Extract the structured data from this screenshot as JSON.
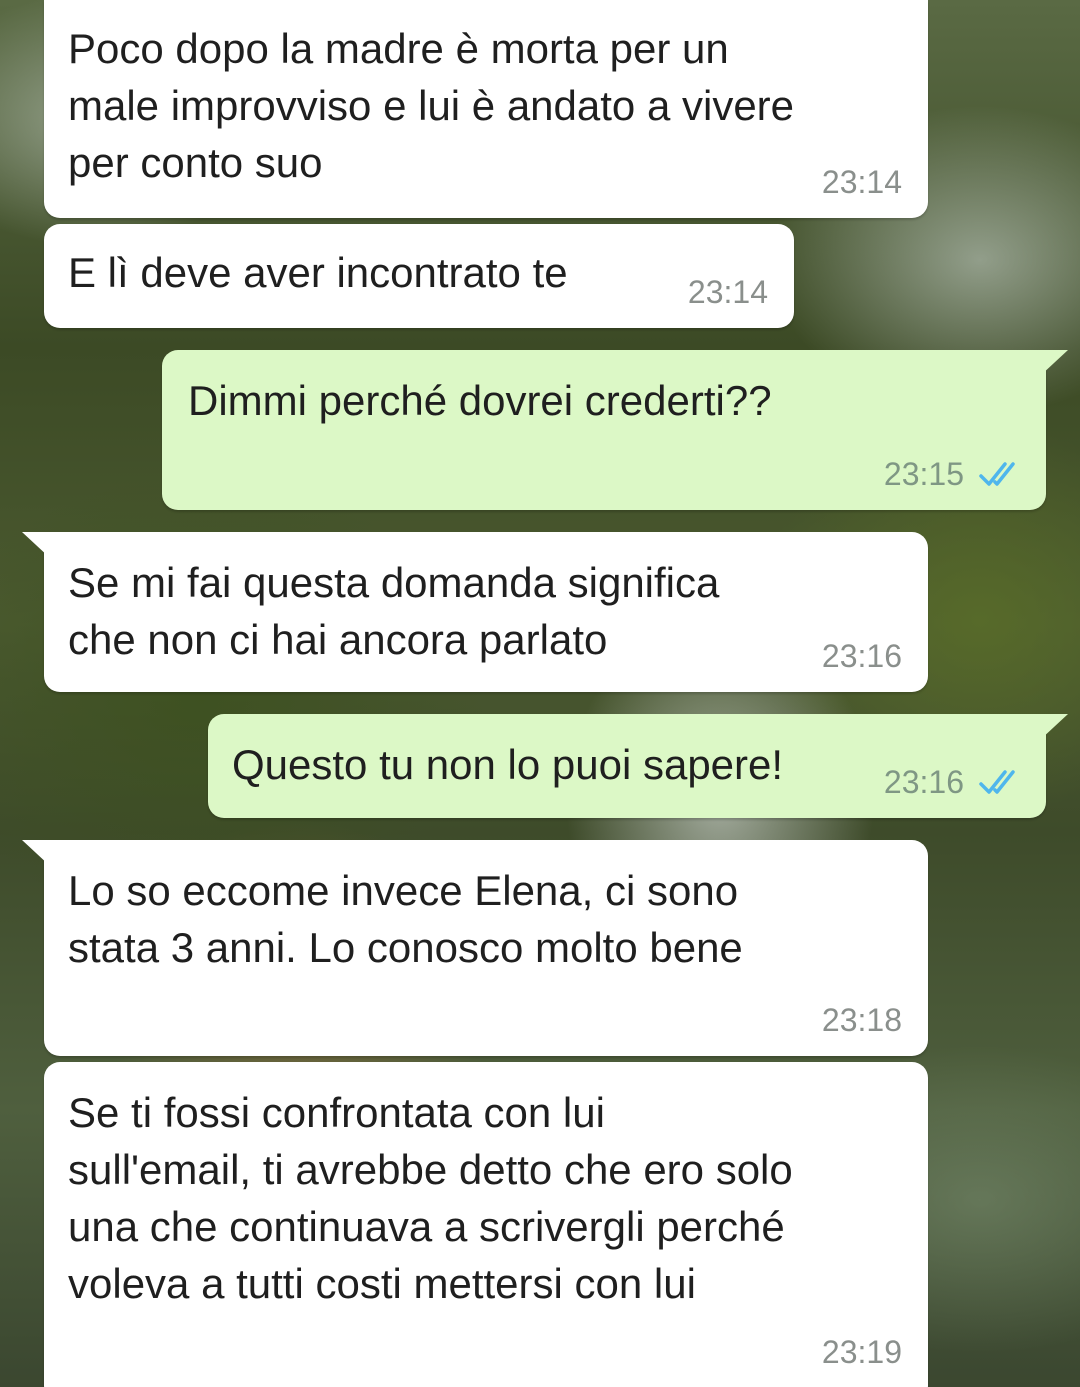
{
  "chat": {
    "messages": [
      {
        "direction": "incoming",
        "text": "Poco dopo la madre è morta per un\nmale improvviso e lui è andato a vivere\nper conto suo",
        "time": "23:14"
      },
      {
        "direction": "incoming",
        "text": "E lì deve aver incontrato te",
        "time": "23:14"
      },
      {
        "direction": "outgoing",
        "text": "Dimmi perché dovrei crederti??",
        "time": "23:15",
        "status": "read"
      },
      {
        "direction": "incoming",
        "text": "Se mi fai questa domanda significa\nche non ci hai ancora parlato",
        "time": "23:16"
      },
      {
        "direction": "outgoing",
        "text": "Questo tu non lo puoi sapere!",
        "time": "23:16",
        "status": "read"
      },
      {
        "direction": "incoming",
        "text": "Lo so eccome invece Elena, ci sono\nstata 3 anni. Lo conosco molto bene",
        "time": "23:18"
      },
      {
        "direction": "incoming",
        "text": "Se ti fossi confrontata con lui\nsull'email, ti avrebbe detto che ero solo\nuna che continuava a scrivergli perché\nvoleva a tutti costi mettersi con lui",
        "time": "23:19"
      }
    ]
  },
  "colors": {
    "incoming_bubble": "#ffffff",
    "outgoing_bubble": "#dcf8c6",
    "read_ticks": "#4fb6ec",
    "timestamp": "#8a8f8c"
  },
  "icons": {
    "read_receipt": "double-check-icon"
  }
}
